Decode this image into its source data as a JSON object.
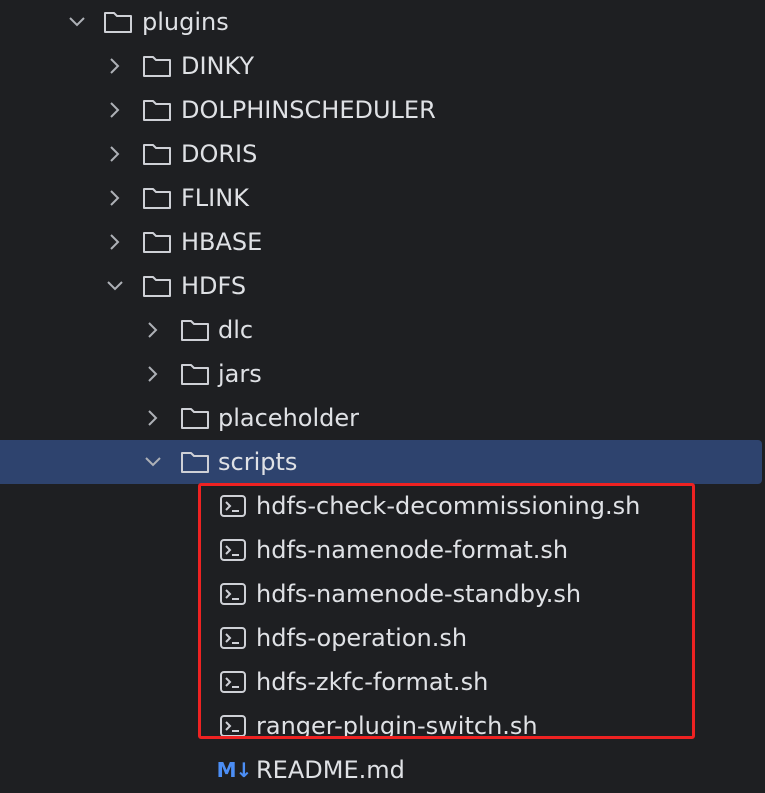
{
  "tree": {
    "plugins": {
      "label": "plugins",
      "expanded": true
    },
    "plugin_children": [
      {
        "label": "DINKY",
        "expanded": false
      },
      {
        "label": "DOLPHINSCHEDULER",
        "expanded": false
      },
      {
        "label": "DORIS",
        "expanded": false
      },
      {
        "label": "FLINK",
        "expanded": false
      },
      {
        "label": "HBASE",
        "expanded": false
      },
      {
        "label": "HDFS",
        "expanded": true
      }
    ],
    "hdfs_children": [
      {
        "label": "dlc",
        "expanded": false
      },
      {
        "label": "jars",
        "expanded": false
      },
      {
        "label": "placeholder",
        "expanded": false
      },
      {
        "label": "scripts",
        "expanded": true,
        "selected": true
      }
    ],
    "script_files": [
      {
        "label": "hdfs-check-decommissioning.sh",
        "icon": "shell-script-icon"
      },
      {
        "label": "hdfs-namenode-format.sh",
        "icon": "shell-script-icon"
      },
      {
        "label": "hdfs-namenode-standby.sh",
        "icon": "shell-script-icon"
      },
      {
        "label": "hdfs-operation.sh",
        "icon": "shell-script-icon"
      },
      {
        "label": "hdfs-zkfc-format.sh",
        "icon": "shell-script-icon"
      },
      {
        "label": "ranger-plugin-switch.sh",
        "icon": "shell-script-icon"
      }
    ],
    "readme": {
      "label": "README.md",
      "icon_text": "M↓",
      "icon": "markdown-icon"
    }
  },
  "colors": {
    "background": "#1e1f22",
    "selection": "#2e436e",
    "highlight_border": "#ee2222",
    "markdown_icon": "#4c8ef5",
    "text": "#dfe1e5"
  }
}
